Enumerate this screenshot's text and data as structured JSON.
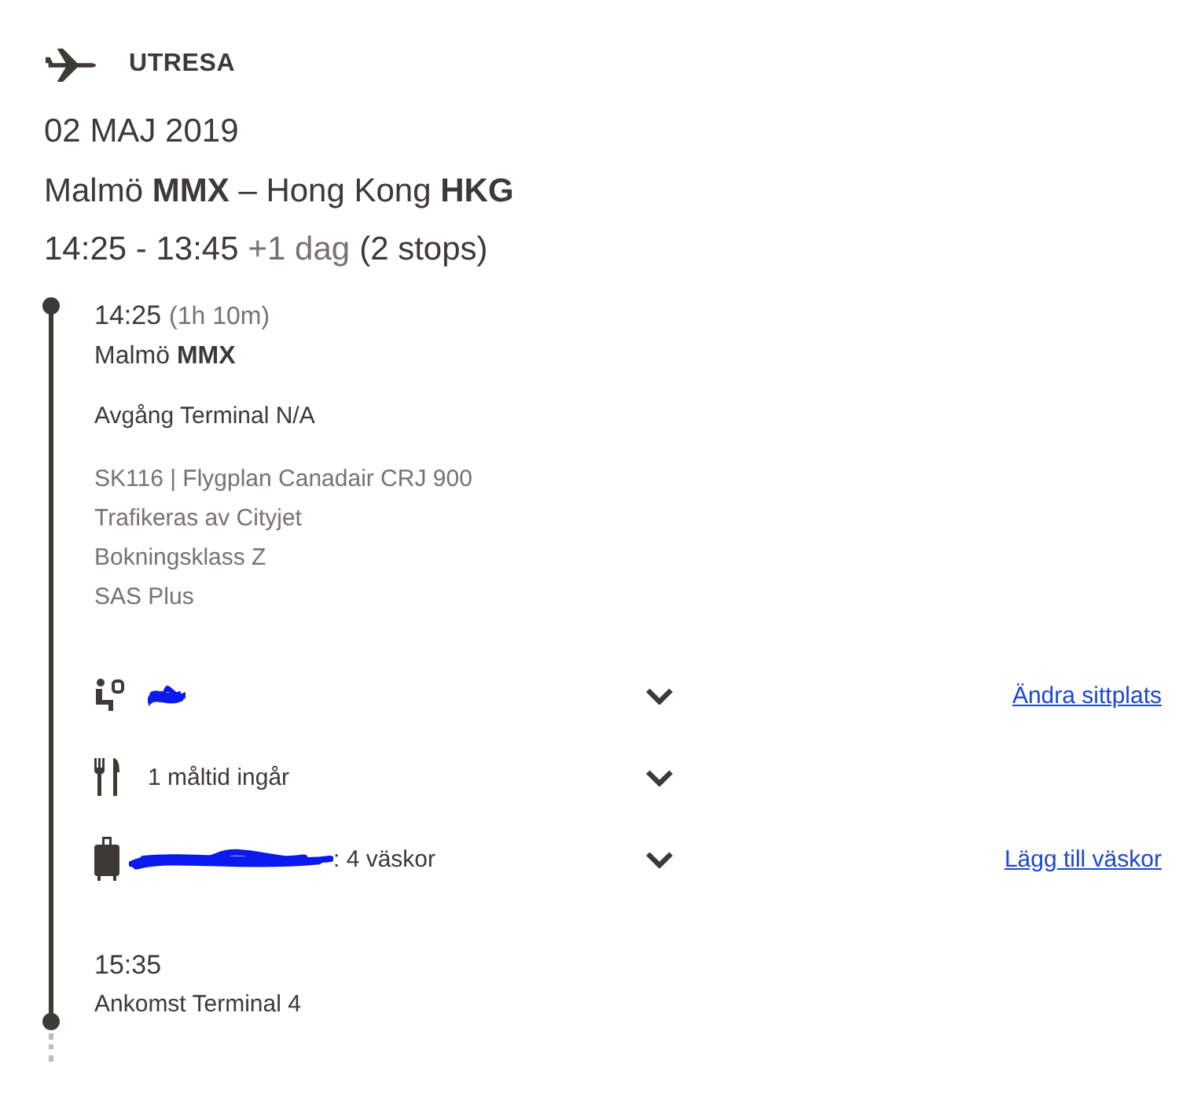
{
  "heading": {
    "label": "UTRESA"
  },
  "date": "02 MAJ 2019",
  "route": "Malmö **MMX** – Hong Kong **HKG**",
  "times": {
    "span": "14:25 - 13:45",
    "extra_day": "+1 dag",
    "stops": "(2 stops)"
  },
  "segment": {
    "departure_time": "14:25",
    "duration": "(1h 10m)",
    "origin": "Malmö **MMX**",
    "departure_terminal": "Avgång Terminal N/A",
    "details": [
      "SK116 | Flygplan Canadair CRJ 900",
      "Trafikeras av Cityjet",
      "Bokningsklass Z",
      "SAS Plus"
    ],
    "services": [
      {
        "kind": "seat",
        "redacted": true,
        "link": "Ändra sittplats"
      },
      {
        "kind": "meal",
        "text": "1 måltid ingår",
        "redacted": false
      },
      {
        "kind": "baggage",
        "text": ": 4 väskor",
        "redacted": true,
        "link": "Lägg till väskor"
      }
    ],
    "arrival_time": "15:35",
    "arrival_terminal": "Ankomst Terminal 4"
  }
}
